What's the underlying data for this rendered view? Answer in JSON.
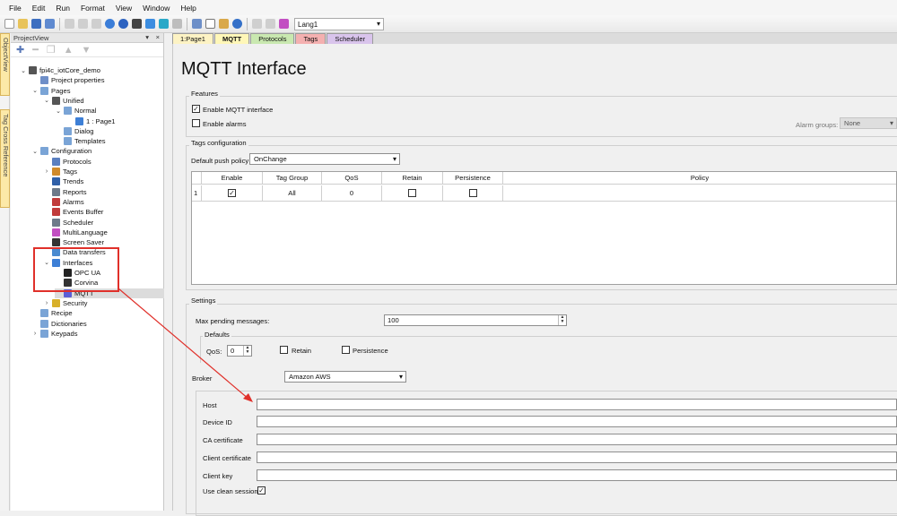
{
  "menu": [
    "File",
    "Edit",
    "Run",
    "Format",
    "View",
    "Window",
    "Help"
  ],
  "toolbar": {
    "language": "Lang1"
  },
  "side_tabs": [
    "ObjectView",
    "Tag Cross Reference"
  ],
  "project_view": {
    "title": "ProjectView",
    "pin": "▾ ×",
    "tree": [
      {
        "label": "fpi4c_iotCore_demo",
        "icon": "monitor-icon",
        "color": "#555"
      },
      {
        "label": "Project properties",
        "icon": "properties-icon",
        "color": "#6f8fc8"
      },
      {
        "label": "Pages",
        "icon": "folder-icon",
        "color": "#7aa4d6"
      },
      {
        "label": "Unified",
        "icon": "page-icon",
        "color": "#555"
      },
      {
        "label": "Normal",
        "icon": "folder-icon",
        "color": "#7aa4d6"
      },
      {
        "label": "1 : Page1",
        "icon": "home-icon",
        "color": "#3d7fd6"
      },
      {
        "label": "Dialog",
        "icon": "folder-icon",
        "color": "#7aa4d6"
      },
      {
        "label": "Templates",
        "icon": "folder-icon",
        "color": "#7aa4d6"
      },
      {
        "label": "Configuration",
        "icon": "folder-icon",
        "color": "#7aa4d6"
      },
      {
        "label": "Protocols",
        "icon": "protocols-icon",
        "color": "#5a7fc0"
      },
      {
        "label": "Tags",
        "icon": "tags-icon",
        "color": "#d08a2a"
      },
      {
        "label": "Trends",
        "icon": "trends-icon",
        "color": "#2f5fa8"
      },
      {
        "label": "Reports",
        "icon": "reports-icon",
        "color": "#6d7a8a"
      },
      {
        "label": "Alarms",
        "icon": "alarm-icon",
        "color": "#c13b3b"
      },
      {
        "label": "Events Buffer",
        "icon": "events-icon",
        "color": "#c13b3b"
      },
      {
        "label": "Scheduler",
        "icon": "scheduler-icon",
        "color": "#6d7a8a"
      },
      {
        "label": "MultiLanguage",
        "icon": "language-icon",
        "color": "#c24fc2"
      },
      {
        "label": "Screen Saver",
        "icon": "screensaver-icon",
        "color": "#333"
      },
      {
        "label": "Data transfers",
        "icon": "transfer-icon",
        "color": "#4a8ad0"
      },
      {
        "label": "Interfaces",
        "icon": "cloud-icon",
        "color": "#3d7fd6"
      },
      {
        "label": "OPC UA",
        "icon": "opcua-icon",
        "color": "#222"
      },
      {
        "label": "Corvina",
        "icon": "corvina-icon",
        "color": "#333"
      },
      {
        "label": "MQTT",
        "icon": "mqtt-icon",
        "color": "#5b5fd6"
      },
      {
        "label": "Security",
        "icon": "security-icon",
        "color": "#d8b02a"
      },
      {
        "label": "Recipe",
        "icon": "folder-icon",
        "color": "#7aa4d6"
      },
      {
        "label": "Dictionaries",
        "icon": "folder-icon",
        "color": "#7aa4d6"
      },
      {
        "label": "Keypads",
        "icon": "folder-icon",
        "color": "#7aa4d6"
      }
    ]
  },
  "tabs": [
    {
      "label": "1:Page1",
      "color": "#fdf3c4"
    },
    {
      "label": "MQTT",
      "color": "#fff7b8"
    },
    {
      "label": "Protocols",
      "color": "#c9e8b0"
    },
    {
      "label": "Tags",
      "color": "#f4b0b0"
    },
    {
      "label": "Scheduler",
      "color": "#d9c4ec"
    }
  ],
  "page_title": "MQTT Interface",
  "features": {
    "label": "Features",
    "enable_mqtt": "Enable MQTT interface",
    "enable_alarms": "Enable alarms",
    "alarm_groups_label": "Alarm groups:",
    "alarm_groups_value": "None"
  },
  "tags_config": {
    "label": "Tags configuration",
    "push_policy_label": "Default push policy",
    "push_policy_value": "OnChange",
    "columns": [
      "Enable",
      "Tag Group",
      "QoS",
      "Retain",
      "Persistence",
      "Policy"
    ],
    "rows": [
      {
        "num": "1",
        "tag_group": "All",
        "qos": "0"
      }
    ]
  },
  "settings": {
    "label": "Settings",
    "max_pending_label": "Max pending messages:",
    "max_pending_value": "100",
    "defaults_label": "Defaults",
    "qos_label": "QoS:",
    "qos_value": "0",
    "retain_label": "Retain",
    "persistence_label": "Persistence",
    "broker_label": "Broker",
    "broker_value": "Amazon AWS",
    "host_label": "Host",
    "device_id_label": "Device ID",
    "ca_cert_label": "CA certificate",
    "client_cert_label": "Client certificate",
    "client_key_label": "Client key",
    "clean_session_label": "Use clean session"
  },
  "annotation_color": "#e0302a"
}
